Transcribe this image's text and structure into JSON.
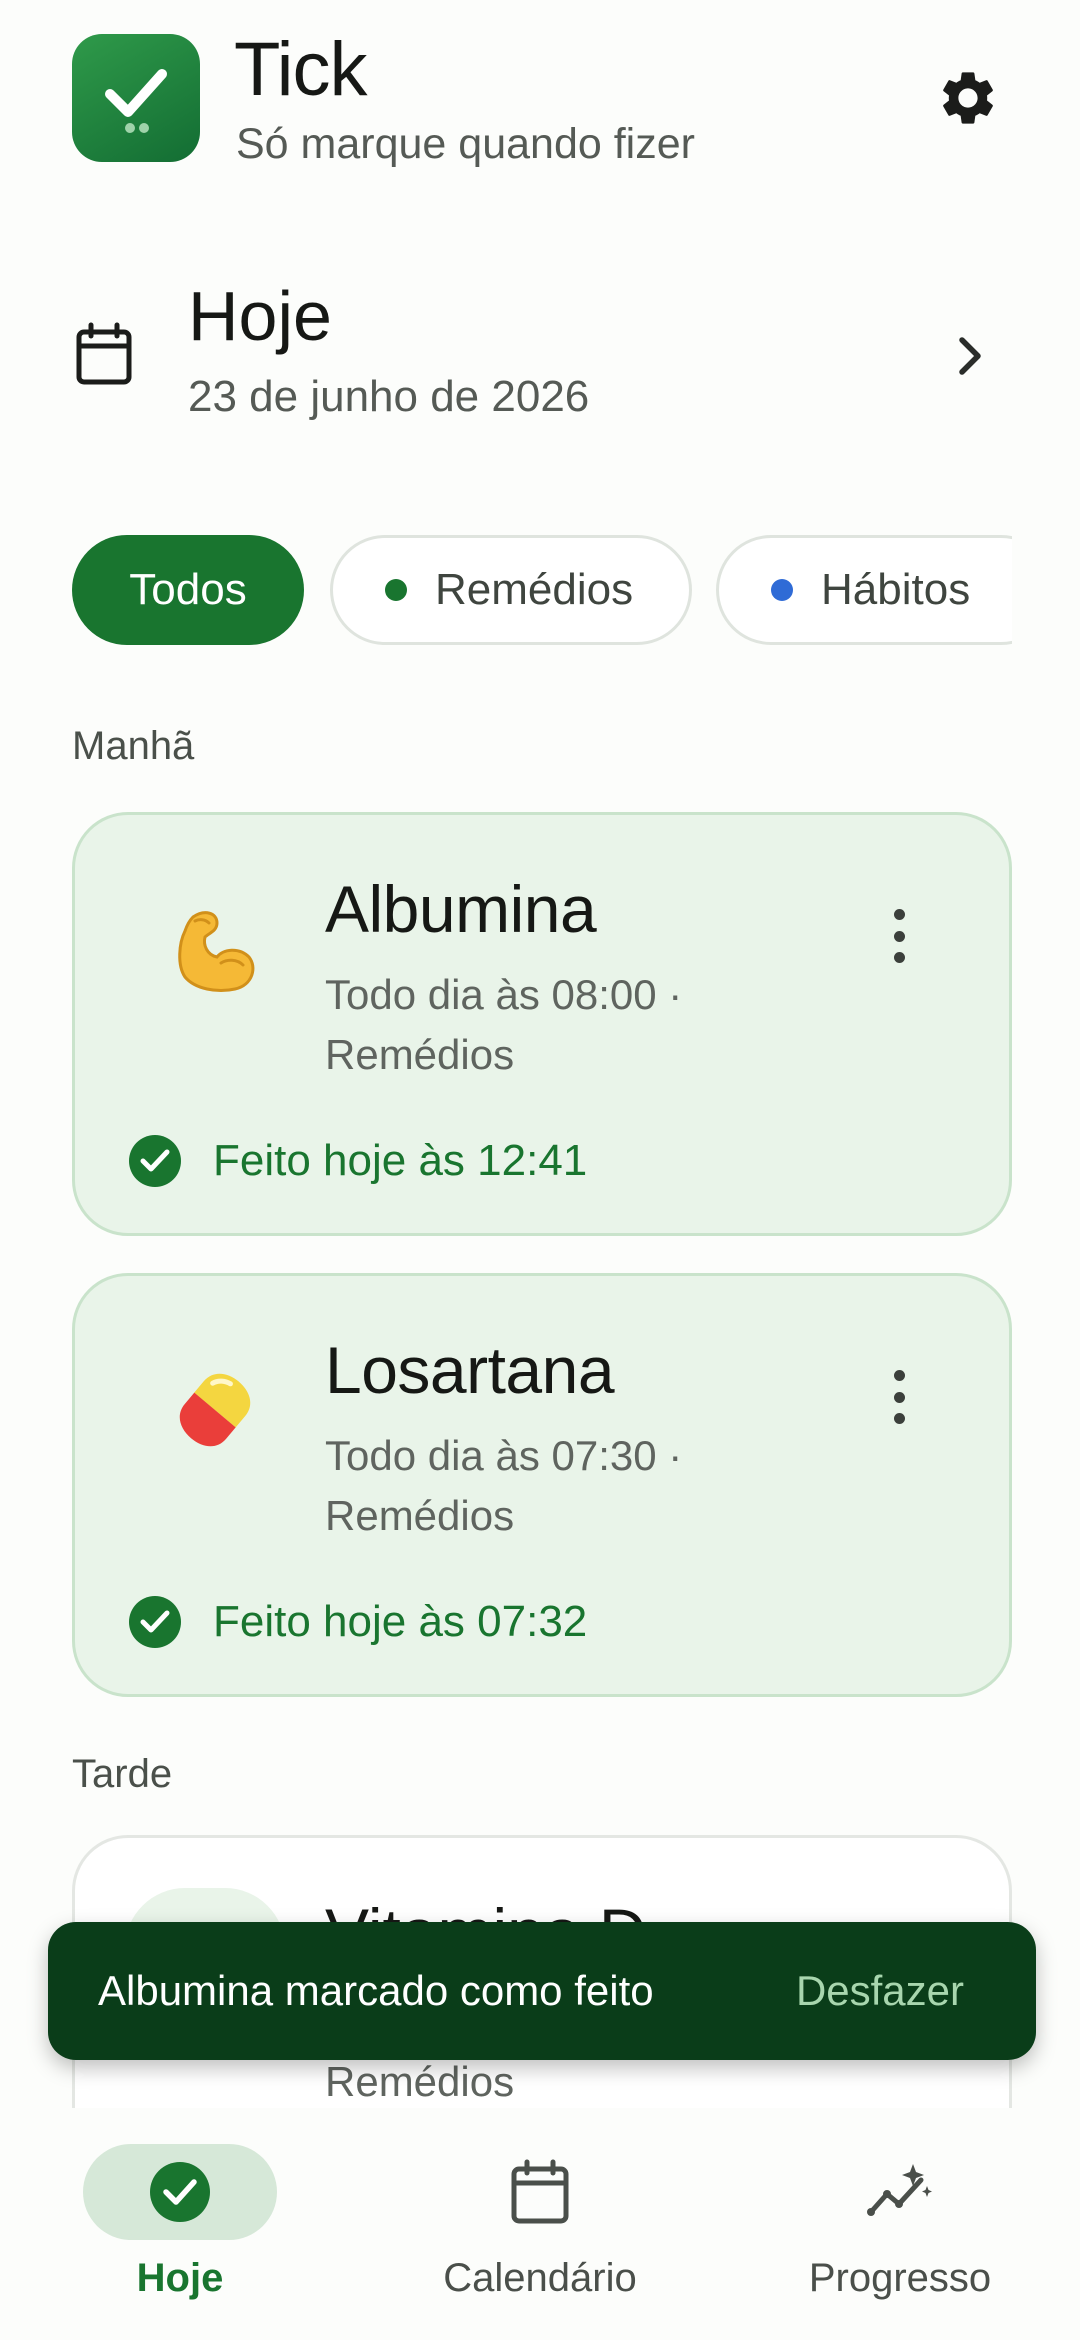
{
  "app": {
    "title": "Tick",
    "subtitle": "Só marque quando fizer"
  },
  "date": {
    "title": "Hoje",
    "subtitle": "23 de junho de 2026"
  },
  "filters": [
    {
      "label": "Todos",
      "selected": true
    },
    {
      "label": "Remédios",
      "dot_color": "#19752f",
      "selected": false
    },
    {
      "label": "Hábitos",
      "dot_color": "#2f6bd6",
      "selected": false
    }
  ],
  "sections": {
    "morning": "Manhã",
    "afternoon": "Tarde"
  },
  "items": [
    {
      "emoji": "💪",
      "name": "Albumina",
      "schedule": "Todo dia às 08:00 ·",
      "category": "Remédios",
      "status": "Feito hoje às 12:41"
    },
    {
      "emoji": "💊",
      "name": "Losartana",
      "schedule": "Todo dia às 07:30 ·",
      "category": "Remédios",
      "status": "Feito hoje às 07:32"
    }
  ],
  "partial_item": {
    "name": "Vitamina D",
    "category": "Remédios"
  },
  "snackbar": {
    "message": "Albumina marcado como feito",
    "action": "Desfazer"
  },
  "nav": [
    {
      "label": "Hoje",
      "active": true
    },
    {
      "label": "Calendário",
      "active": false
    },
    {
      "label": "Progresso",
      "active": false
    }
  ],
  "colors": {
    "primary": "#19752f",
    "card_bg": "#e9f4e9",
    "snackbar_bg": "#0a3d19",
    "habit_dot": "#2f6bd6"
  }
}
